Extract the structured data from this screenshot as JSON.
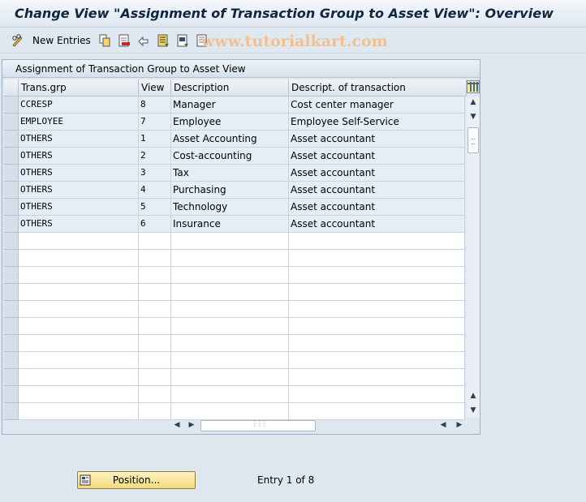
{
  "window": {
    "title": "Change View \"Assignment of Transaction Group to Asset View\": Overview"
  },
  "toolbar": {
    "new_entries_label": "New Entries",
    "watermark": "www.tutorialkart.com",
    "icons": [
      "pencil-glasses-icon",
      "copy-icon",
      "delete-icon",
      "undo-icon",
      "select-all-icon",
      "select-block-icon",
      "deselect-all-icon"
    ]
  },
  "table": {
    "title": "Assignment of Transaction Group to Asset View",
    "columns": [
      "Trans.grp",
      "View",
      "Description",
      "Descript. of transaction"
    ],
    "rows": [
      [
        "CCRESP",
        "8",
        "Manager",
        "Cost center manager"
      ],
      [
        "EMPLOYEE",
        "7",
        "Employee",
        "Employee Self-Service"
      ],
      [
        "OTHERS",
        "1",
        "Asset Accounting",
        "Asset accountant"
      ],
      [
        "OTHERS",
        "2",
        "Cost-accounting",
        "Asset accountant"
      ],
      [
        "OTHERS",
        "3",
        "Tax",
        "Asset accountant"
      ],
      [
        "OTHERS",
        "4",
        "Purchasing",
        "Asset accountant"
      ],
      [
        "OTHERS",
        "5",
        "Technology",
        "Asset accountant"
      ],
      [
        "OTHERS",
        "6",
        "Insurance",
        "Asset accountant"
      ]
    ],
    "empty_rows": 11
  },
  "footer": {
    "position_button_label": "Position...",
    "entry_info": "Entry 1 of 8"
  },
  "colors": {
    "background": "#dfe8f1",
    "filled_row": "#e4eef7",
    "button_yellow": "#f2da7c",
    "title_text": "#10253f"
  }
}
